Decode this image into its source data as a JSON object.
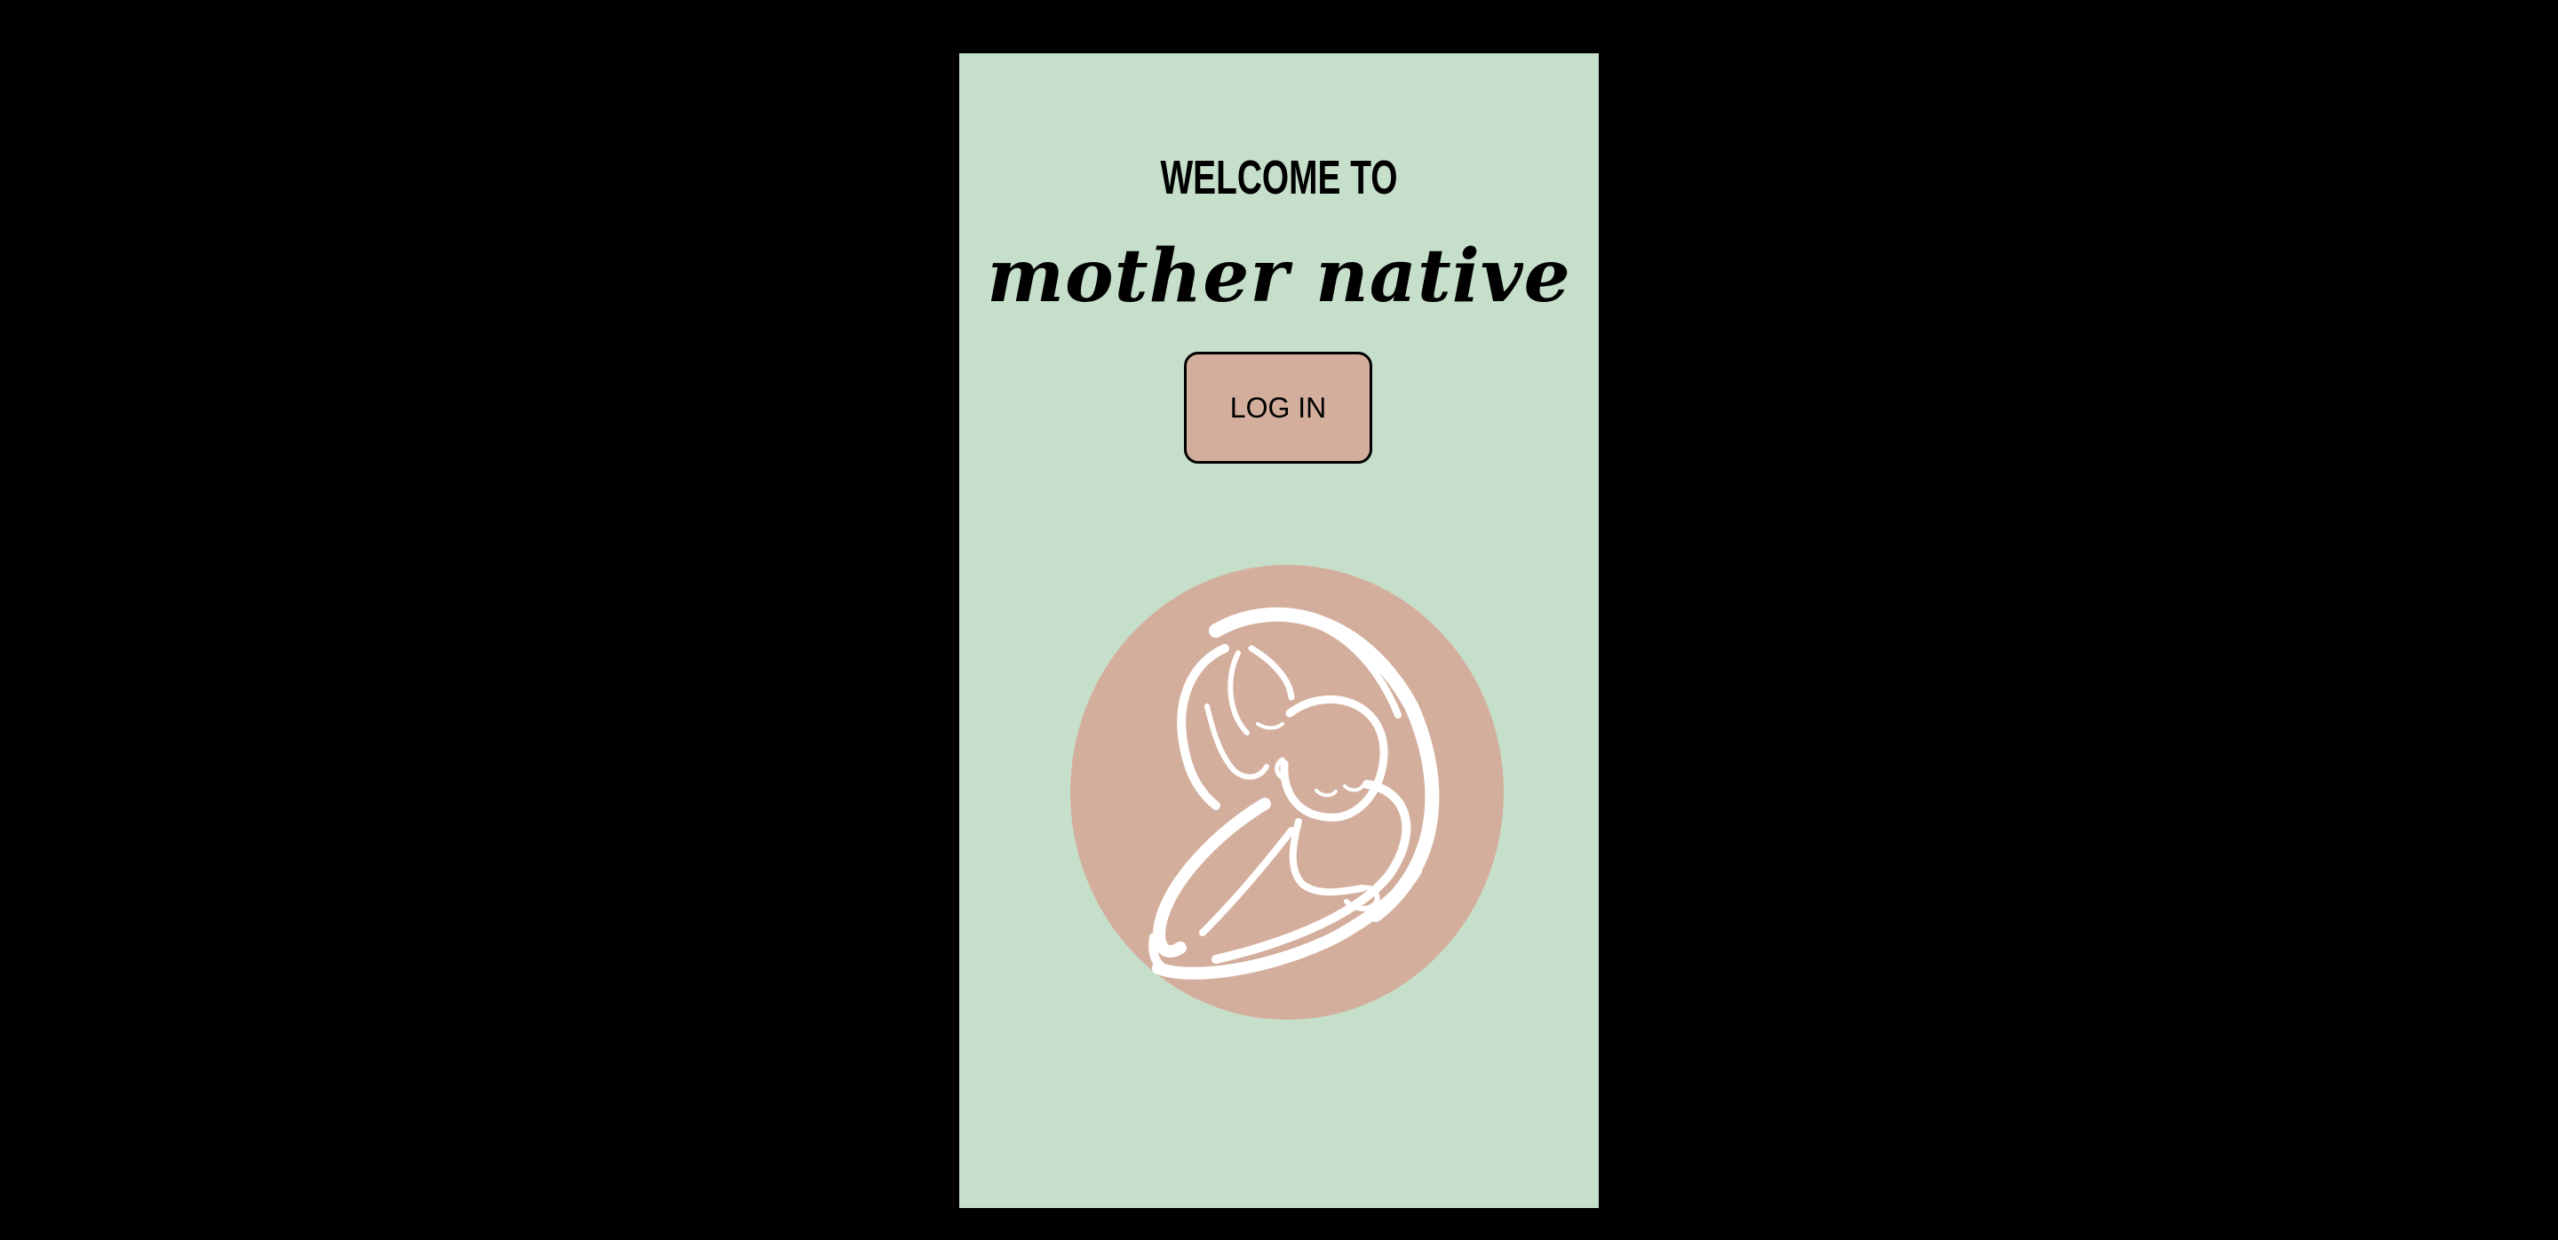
{
  "welcome_screen": {
    "heading": "WELCOME TO",
    "app_name": "mother native",
    "login_label": "LOG IN",
    "logo_icon": "mother-and-baby-icon"
  },
  "colors": {
    "outer_background": "#000000",
    "screen_background": "#c6dfcb",
    "accent_rose": "#d4ae9c",
    "text": "#000000",
    "logo_line": "#ffffff"
  }
}
